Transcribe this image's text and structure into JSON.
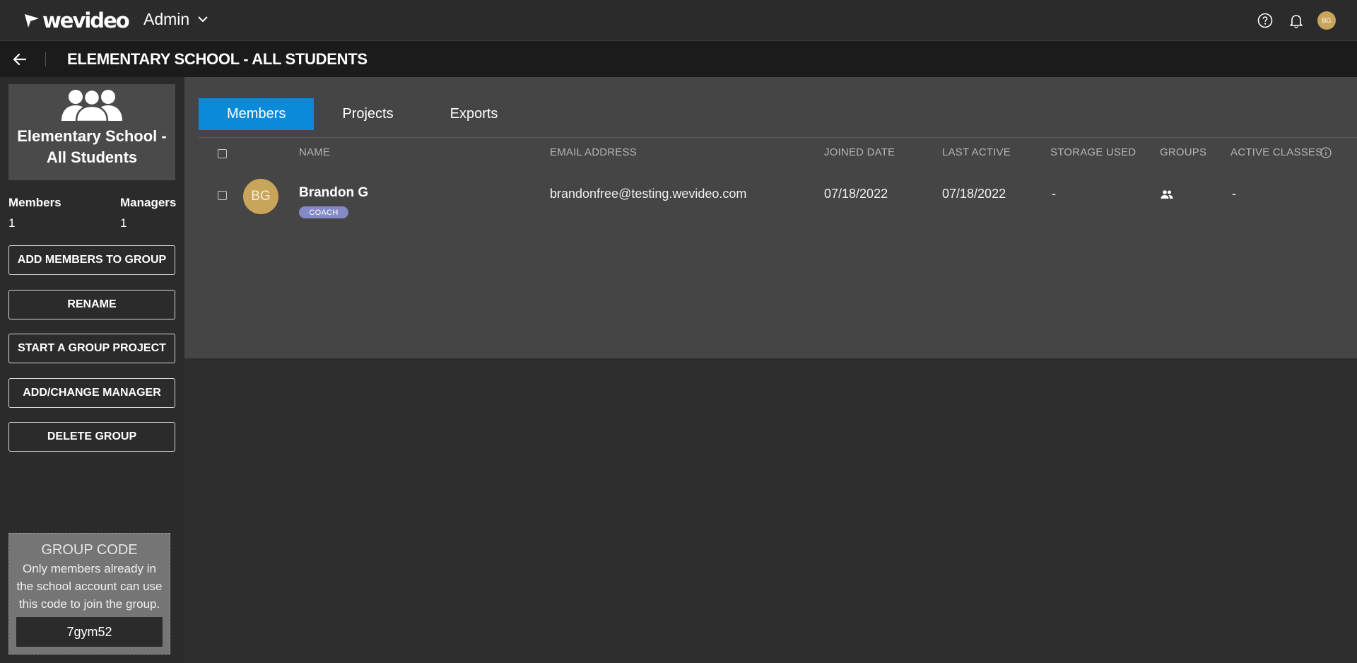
{
  "nav": {
    "brand": "wevideo",
    "role_label": "Admin",
    "user_initials": "BG"
  },
  "header": {
    "title": "ELEMENTARY SCHOOL - ALL STUDENTS"
  },
  "sidebar": {
    "group_name": "Elementary School - All Students",
    "stats": {
      "members_label": "Members",
      "members_value": "1",
      "managers_label": "Managers",
      "managers_value": "1"
    },
    "buttons": {
      "add_members": "ADD MEMBERS TO GROUP",
      "rename": "RENAME",
      "start_project": "START A GROUP PROJECT",
      "change_manager": "ADD/CHANGE MANAGER",
      "delete_group": "DELETE GROUP"
    },
    "group_code": {
      "title": "GROUP CODE",
      "description": "Only members already in the school account can use this code to join the group.",
      "code": "7gym52"
    }
  },
  "main": {
    "tabs": [
      "Members",
      "Projects",
      "Exports"
    ],
    "active_tab": "Members",
    "columns": {
      "name": "NAME",
      "email": "EMAIL ADDRESS",
      "joined": "JOINED DATE",
      "last_active": "LAST ACTIVE",
      "storage": "STORAGE USED",
      "groups": "GROUPS",
      "active_classes": "ACTIVE CLASSES"
    },
    "rows": [
      {
        "initials": "BG",
        "name": "Brandon G",
        "role": "COACH",
        "email": "brandonfree@testing.wevideo.com",
        "joined": "07/18/2022",
        "last_active": "07/18/2022",
        "storage": "-",
        "active_classes": "-"
      }
    ]
  },
  "colors": {
    "accent": "#0a8ad8",
    "avatar": "#c9a55b",
    "badge": "#8489c7",
    "panel": "#454545"
  }
}
